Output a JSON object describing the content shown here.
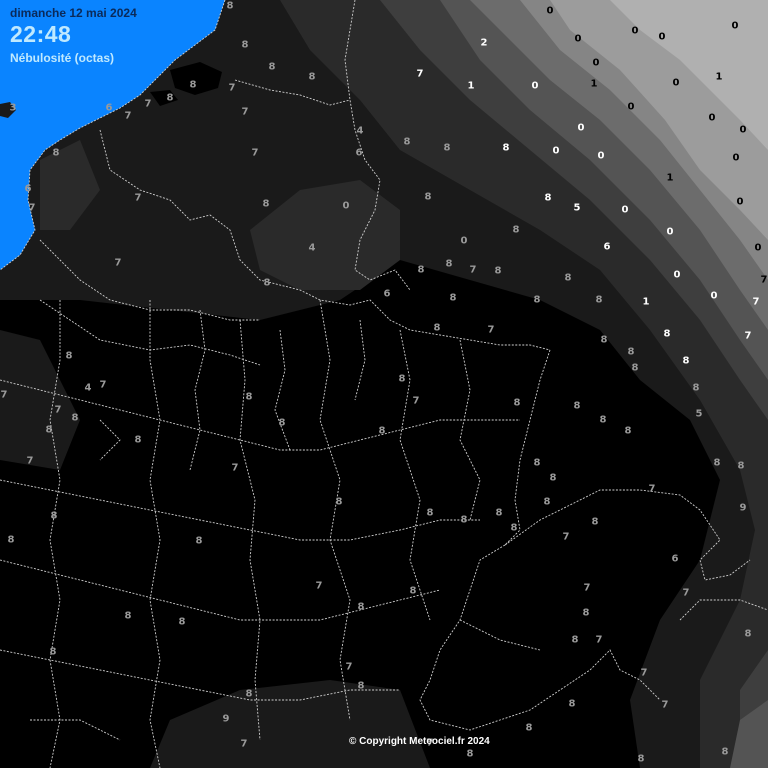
{
  "header": {
    "date": "dimanche 12 mai 2024",
    "time": "22:48",
    "subtitle": "Nébulosité (octas)"
  },
  "footer": {
    "copyright": "© Copyright Meteociel.fr 2024"
  },
  "colors": {
    "sea": "#0a84ff",
    "cloud_8": "#000000",
    "cloud_7": "#1a1a1a",
    "cloud_6": "#2a2a2a",
    "cloud_5": "#3e3e3e",
    "cloud_4": "#545454",
    "cloud_3": "#6c6c6c",
    "cloud_2": "#858585",
    "cloud_1": "#9c9c9c",
    "cloud_0": "#b0b0b0",
    "borders": "#cfcfcf",
    "header_time": "#bfe9ff",
    "header_date": "#0a2a5a"
  },
  "observations": [
    {
      "v": "8"
    },
    {
      "v": "8"
    },
    {
      "v": "8"
    },
    {
      "v": "8"
    },
    {
      "v": "7"
    },
    {
      "v": "8"
    },
    {
      "v": "8"
    },
    {
      "v": "7"
    },
    {
      "v": "7"
    },
    {
      "v": "6"
    },
    {
      "v": "3"
    },
    {
      "v": "8"
    },
    {
      "v": "6"
    },
    {
      "v": "7"
    },
    {
      "v": "7"
    },
    {
      "v": "7"
    },
    {
      "v": "0"
    },
    {
      "v": "7"
    },
    {
      "v": "4"
    },
    {
      "v": "7"
    },
    {
      "v": "8"
    },
    {
      "v": "8"
    },
    {
      "v": "6"
    },
    {
      "v": "4"
    },
    {
      "v": "6"
    },
    {
      "v": "8"
    },
    {
      "v": "7"
    },
    {
      "v": "2"
    },
    {
      "v": "1"
    },
    {
      "v": "0"
    },
    {
      "v": "0"
    },
    {
      "v": "0"
    },
    {
      "v": "0"
    },
    {
      "v": "0"
    },
    {
      "v": "0"
    },
    {
      "v": "1"
    },
    {
      "v": "0"
    },
    {
      "v": "1"
    },
    {
      "v": "0"
    },
    {
      "v": "0"
    },
    {
      "v": "0"
    },
    {
      "v": "0"
    },
    {
      "v": "0"
    },
    {
      "v": "8"
    },
    {
      "v": "0"
    },
    {
      "v": "0"
    },
    {
      "v": "0"
    },
    {
      "v": "1"
    },
    {
      "v": "8"
    },
    {
      "v": "8"
    },
    {
      "v": "5"
    },
    {
      "v": "0"
    },
    {
      "v": "0"
    },
    {
      "v": "0"
    },
    {
      "v": "8"
    },
    {
      "v": "8"
    },
    {
      "v": "0"
    },
    {
      "v": "8"
    },
    {
      "v": "8"
    },
    {
      "v": "7"
    },
    {
      "v": "8"
    },
    {
      "v": "6"
    },
    {
      "v": "8"
    },
    {
      "v": "8"
    },
    {
      "v": "8"
    },
    {
      "v": "8"
    },
    {
      "v": "8"
    },
    {
      "v": "7"
    },
    {
      "v": "1"
    },
    {
      "v": "0"
    },
    {
      "v": "0"
    },
    {
      "v": "0"
    },
    {
      "v": "8"
    },
    {
      "v": "8"
    },
    {
      "v": "8"
    },
    {
      "v": "8"
    },
    {
      "v": "8"
    },
    {
      "v": "8"
    },
    {
      "v": "8"
    },
    {
      "v": "8"
    },
    {
      "v": "8"
    },
    {
      "v": "5"
    },
    {
      "v": "8"
    },
    {
      "v": "7"
    },
    {
      "v": "8"
    },
    {
      "v": "8"
    },
    {
      "v": "8"
    },
    {
      "v": "8"
    },
    {
      "v": "8"
    },
    {
      "v": "8"
    },
    {
      "v": "7"
    },
    {
      "v": "4"
    },
    {
      "v": "8"
    },
    {
      "v": "8"
    },
    {
      "v": "7"
    },
    {
      "v": "8"
    },
    {
      "v": "7"
    },
    {
      "v": "7"
    },
    {
      "v": "8"
    },
    {
      "v": "7"
    },
    {
      "v": "8"
    },
    {
      "v": "8"
    },
    {
      "v": "8"
    },
    {
      "v": "8"
    },
    {
      "v": "7"
    },
    {
      "v": "8"
    },
    {
      "v": "8"
    },
    {
      "v": "8"
    },
    {
      "v": "8"
    },
    {
      "v": "8"
    },
    {
      "v": "8"
    },
    {
      "v": "7"
    },
    {
      "v": "8"
    },
    {
      "v": "8"
    },
    {
      "v": "8"
    },
    {
      "v": "8"
    },
    {
      "v": "8"
    },
    {
      "v": "8"
    },
    {
      "v": "8"
    },
    {
      "v": "8"
    },
    {
      "v": "7"
    },
    {
      "v": "6"
    },
    {
      "v": "7"
    },
    {
      "v": "8"
    },
    {
      "v": "8"
    },
    {
      "v": "7"
    },
    {
      "v": "7"
    },
    {
      "v": "8"
    },
    {
      "v": "8"
    },
    {
      "v": "7"
    },
    {
      "v": "9"
    },
    {
      "v": "7"
    },
    {
      "v": "8"
    },
    {
      "v": "8"
    },
    {
      "v": "8"
    },
    {
      "v": "7"
    },
    {
      "v": "7"
    },
    {
      "v": "7"
    },
    {
      "v": "8"
    },
    {
      "v": "8"
    },
    {
      "v": "7"
    },
    {
      "v": "7"
    },
    {
      "v": "7"
    },
    {
      "v": "9"
    },
    {
      "v": "7"
    },
    {
      "v": "0"
    },
    {
      "v": "7"
    },
    {
      "v": "8"
    }
  ]
}
